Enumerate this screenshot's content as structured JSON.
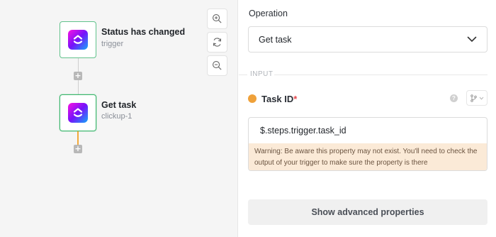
{
  "flow": {
    "trigger": {
      "title": "Status has changed",
      "subtitle": "trigger",
      "icon": "clickup-logo-icon"
    },
    "step": {
      "title": "Get task",
      "subtitle": "clickup-1",
      "icon": "clickup-logo-icon"
    },
    "add_symbol": "+",
    "connector_active_color": "#f2a93b"
  },
  "zoom": {
    "in_icon": "zoom-in-icon",
    "fit_icon": "refresh-icon",
    "out_icon": "zoom-out-icon"
  },
  "panel": {
    "operation_label": "Operation",
    "operation_value": "Get task",
    "section_label": "INPUT",
    "field": {
      "name": "Task ID",
      "required_mark": "*",
      "help_symbol": "?",
      "value": "$.steps.trigger.task_id",
      "warning": "Warning: Be aware this property may not exist. You'll need to check the output of your trigger to make sure the property is there"
    },
    "advanced_button": "Show advanced properties"
  },
  "colors": {
    "accent_green": "#3fb86f",
    "status_dot": "#efa13a",
    "warning_bg": "#fbead7"
  }
}
